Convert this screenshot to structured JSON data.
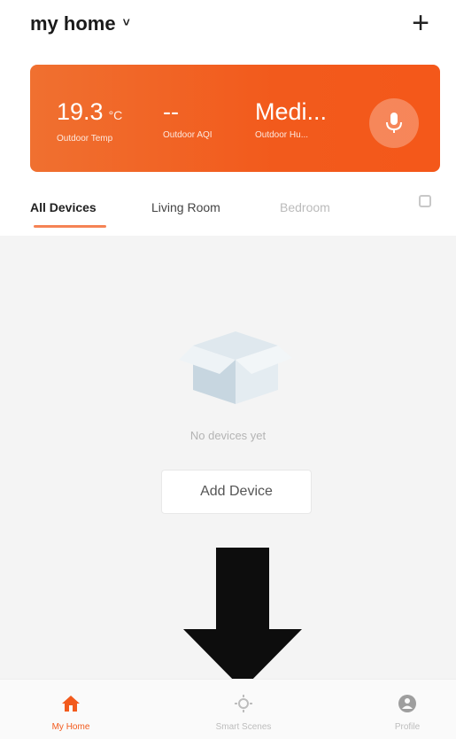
{
  "header": {
    "home_name": "my home",
    "chevron": "˅",
    "add_symbol": "+"
  },
  "weather": {
    "temp_value": "19.3",
    "temp_unit": "°C",
    "temp_label": "Outdoor Temp",
    "aqi_value": "--",
    "aqi_label": "Outdoor AQI",
    "humidity_value": "Medi...",
    "humidity_label": "Outdoor Hu...",
    "accent_color": "#f25a1c"
  },
  "tabs": [
    {
      "label": "All Devices",
      "active": true
    },
    {
      "label": "Living Room",
      "active": false
    },
    {
      "label": "Bedroom",
      "active": false
    }
  ],
  "empty_state": {
    "message": "No devices yet",
    "add_button": "Add Device",
    "icon": "empty-box-icon"
  },
  "bottom_nav": [
    {
      "label": "My Home",
      "icon": "home-icon",
      "active": true
    },
    {
      "label": "Smart Scenes",
      "icon": "smart-scenes-icon",
      "active": false
    },
    {
      "label": "Profile",
      "icon": "profile-icon",
      "active": false
    }
  ]
}
